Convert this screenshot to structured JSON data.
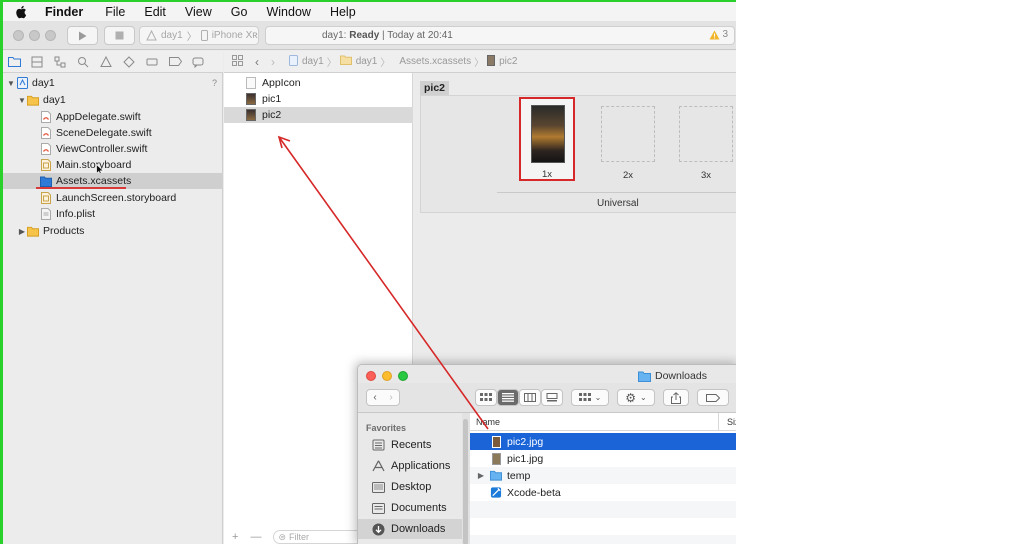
{
  "menubar": {
    "app": "Finder",
    "items": [
      "File",
      "Edit",
      "View",
      "Go",
      "Window",
      "Help"
    ]
  },
  "toolbar": {
    "scheme": "day1",
    "device": "iPhone Xʀ",
    "status_project": "day1:",
    "status_state": "Ready",
    "status_time": "Today at 20:41",
    "warning_count": "3"
  },
  "navigator": {
    "project": "day1",
    "group": "day1",
    "files": [
      "AppDelegate.swift",
      "SceneDelegate.swift",
      "ViewController.swift",
      "Main.storyboard",
      "Assets.xcassets",
      "LaunchScreen.storyboard",
      "Info.plist"
    ],
    "products": "Products",
    "help_mark": "?"
  },
  "jumpbar": {
    "crumbs": [
      "day1",
      "day1",
      "Assets.xcassets",
      "pic2"
    ]
  },
  "assetlist": {
    "items": [
      "AppIcon",
      "pic1",
      "pic2"
    ],
    "filter_placeholder": "Filter",
    "add": "+",
    "remove": "—"
  },
  "editor": {
    "set_name": "pic2",
    "slots": [
      "1x",
      "2x",
      "3x"
    ],
    "idiom": "Universal"
  },
  "finder": {
    "title": "Downloads",
    "sidebar_heading": "Favorites",
    "sidebar_items": [
      "Recents",
      "Applications",
      "Desktop",
      "Documents",
      "Downloads"
    ],
    "column_name": "Name",
    "column_size": "Siz",
    "files": [
      "pic2.jpg",
      "pic1.jpg",
      "temp",
      "Xcode-beta"
    ]
  },
  "colors": {
    "annotation_red": "#d62828",
    "selection_blue": "#1a64d8",
    "border_green": "#2ad12a"
  }
}
